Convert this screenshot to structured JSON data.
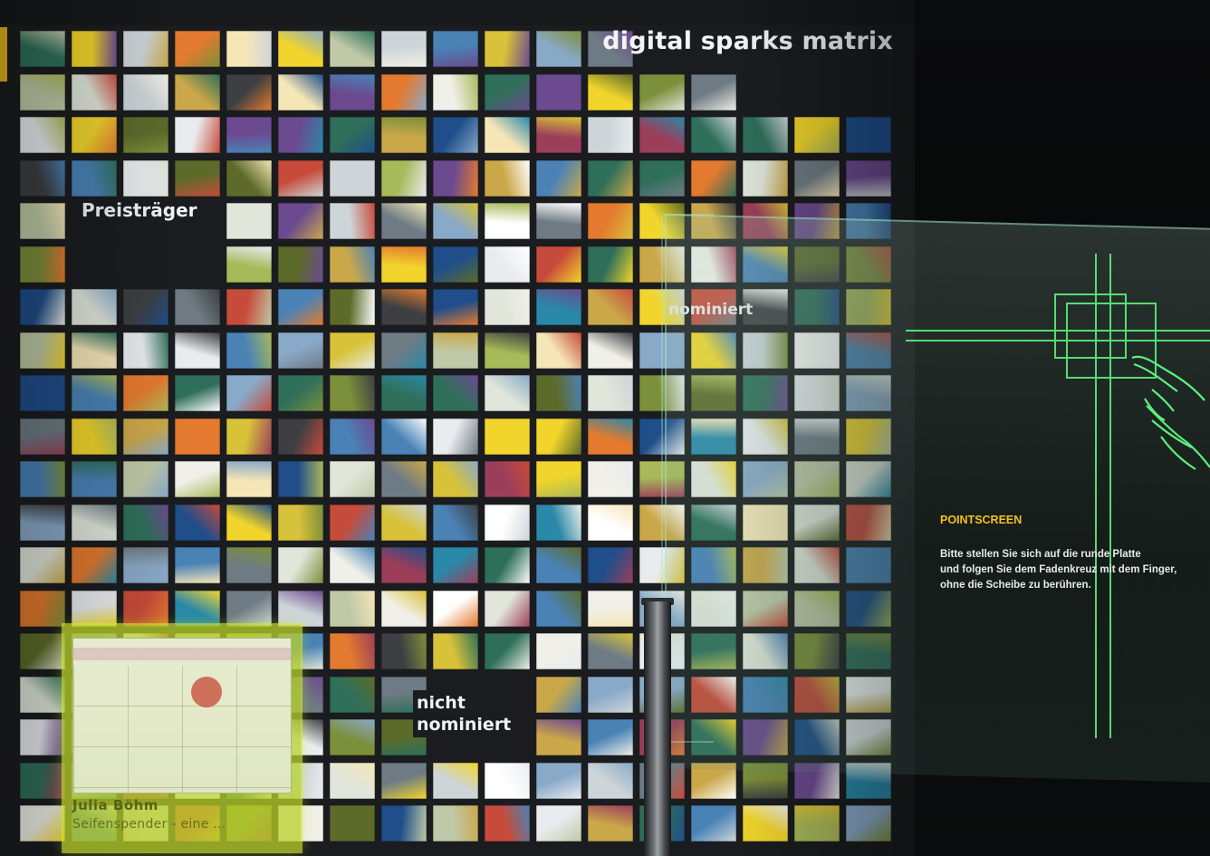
{
  "wall": {
    "title": "digital sparks matrix",
    "label_award": "Preisträger",
    "label_not_nominated_1": "nicht",
    "label_not_nominated_2": "nominiert",
    "label_nominated": "nominiert"
  },
  "pointscreen": {
    "title": "POINTSCREEN",
    "instructions": [
      "Bitte stellen Sie sich auf die runde Platte",
      "und folgen Sie dem Fadenkreuz mit dem Finger,",
      "ohne die Scheibe zu berühren."
    ]
  },
  "selected_card": {
    "name": "Julia Böhm",
    "subtitle": "Seifenspender - eine ..."
  },
  "colors": {
    "accent_yellow": "#f0c21e",
    "crosshair_green": "#5cf07a",
    "card_lime": "#bad228"
  }
}
